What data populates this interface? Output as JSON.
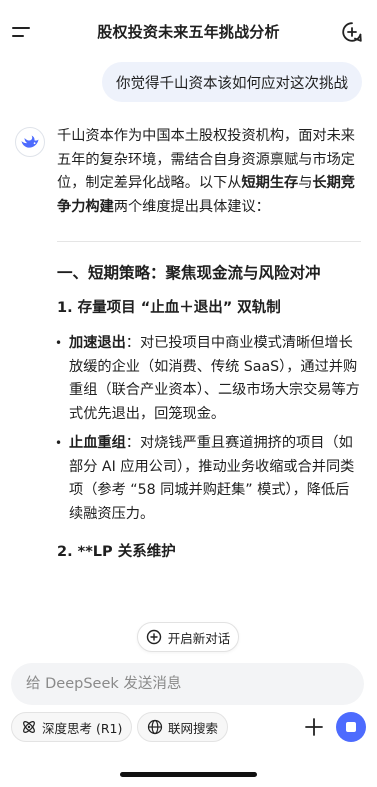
{
  "header": {
    "title": "股权投资未来五年挑战分析"
  },
  "user_message": "你觉得千山资本该如何应对这次挑战",
  "answer": {
    "intro_part1": "千山资本作为中国本土股权投资机构，面对未来五年的复杂环境，需结合自身资源禀赋与市场定位，制定差异化战略。以下从",
    "intro_bold1": "短期生存",
    "intro_mid": "与",
    "intro_bold2": "长期竞争力构建",
    "intro_end": "两个维度提出具体建议：",
    "section1_title": "一、短期策略：聚焦现金流与风险对冲",
    "sub1_title": "1. 存量项目 “止血＋退出” 双轨制",
    "bullets": [
      {
        "label": "加速退出",
        "text": "：对已投项目中商业模式清晰但增长放缓的企业（如消费、传统 SaaS），通过并购重组（联合产业资本）、二级市场大宗交易等方式优先退出，回笼现金。"
      },
      {
        "label": "止血重组",
        "text": "：对烧钱严重且赛道拥挤的项目（如部分 AI 应用公司），推动业务收缩或合并同类项（参考 “58 同城并购赶集” 模式），降低后续融资压力。"
      }
    ],
    "sub2_title": "2. **LP 关系维护"
  },
  "restart_button": "开启新对话",
  "composer": {
    "placeholder": "给 DeepSeek 发送消息",
    "think_chip": "深度思考 (R1)",
    "search_chip": "联网搜索"
  },
  "colors": {
    "accent": "#4d6bfe",
    "bubble": "#eef2fb"
  }
}
